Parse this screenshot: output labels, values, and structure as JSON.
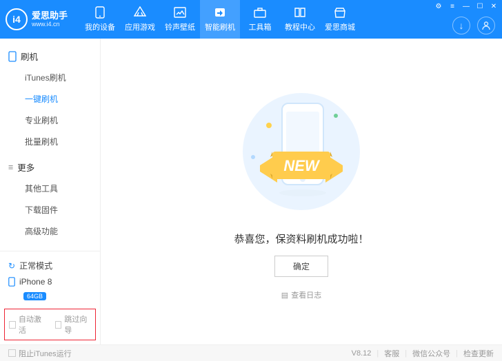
{
  "brand": {
    "title": "爱思助手",
    "subtitle": "www.i4.cn",
    "logo_text": "i4"
  },
  "nav": {
    "items": [
      {
        "label": "我的设备"
      },
      {
        "label": "应用游戏"
      },
      {
        "label": "铃声壁纸"
      },
      {
        "label": "智能刷机"
      },
      {
        "label": "工具箱"
      },
      {
        "label": "教程中心"
      },
      {
        "label": "爱思商城"
      }
    ]
  },
  "sidebar": {
    "section1": {
      "title": "刷机",
      "items": [
        "iTunes刷机",
        "一键刷机",
        "专业刷机",
        "批量刷机"
      ]
    },
    "section2": {
      "title": "更多",
      "items": [
        "其他工具",
        "下载固件",
        "高级功能"
      ]
    },
    "status": {
      "mode": "正常模式",
      "device": "iPhone 8",
      "storage": "64GB"
    },
    "options": {
      "auto_activate": "自动激活",
      "skip_guide": "跳过向导"
    }
  },
  "main": {
    "banner_text": "NEW",
    "message": "恭喜您，保资料刷机成功啦！",
    "ok": "确定",
    "view_log": "查看日志"
  },
  "footer": {
    "block_itunes": "阻止iTunes运行",
    "version": "V8.12",
    "support": "客服",
    "wechat": "微信公众号",
    "update": "检查更新"
  }
}
